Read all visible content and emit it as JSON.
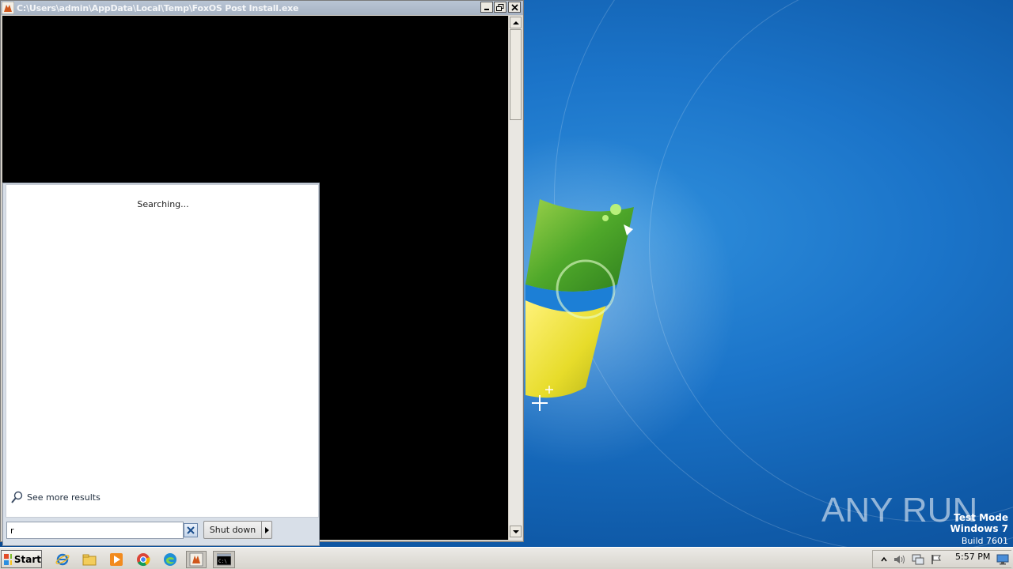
{
  "console": {
    "title": "C:\\Users\\admin\\AppData\\Local\\Temp\\FoxOS Post Install.exe"
  },
  "start_menu": {
    "searching_text": "Searching...",
    "see_more_label": "See more results",
    "search_value": "r",
    "shutdown_label": "Shut down"
  },
  "taskbar": {
    "start_label": "Start",
    "pinned_icons": [
      "internet-explorer-icon",
      "explorer-icon",
      "media-player-icon",
      "chrome-icon",
      "edge-icon",
      "foxos-icon",
      "cmd-icon"
    ],
    "clock": "5:57 PM"
  },
  "watermark": {
    "line1": "Test Mode",
    "line2": "Windows 7",
    "line3": "Build 7601",
    "brand": "ANY RUN"
  },
  "colors": {
    "desktop": "#1b74c9",
    "console_bg": "#000000"
  }
}
